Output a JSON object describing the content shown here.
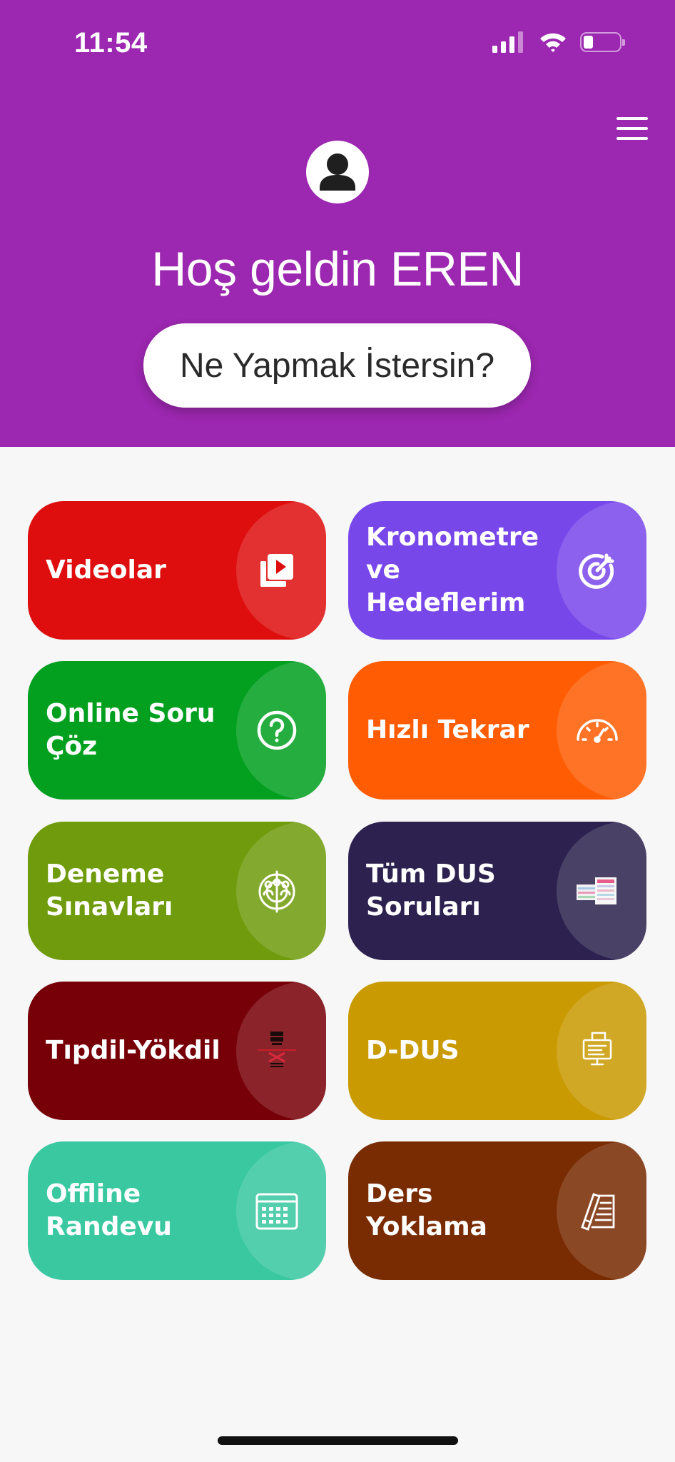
{
  "status_bar": {
    "time": "11:54"
  },
  "header": {
    "greeting": "Hoş geldin EREN",
    "prompt_button": "Ne Yapmak İstersin?",
    "background_color": "#9c27b0"
  },
  "menu": {
    "icon": "hamburger-menu-icon"
  },
  "cards": [
    {
      "label": "Videolar",
      "color": "#df0e0e",
      "icon": "video-library-icon"
    },
    {
      "label": "Kronometre ve Hedeflerim",
      "color": "#7847ea",
      "icon": "target-icon"
    },
    {
      "label": "Online Soru Çöz",
      "color": "#03a020",
      "icon": "question-circle-icon"
    },
    {
      "label": "Hızlı Tekrar",
      "color": "#ff5c03",
      "icon": "speedometer-icon"
    },
    {
      "label": "Deneme Sınavları",
      "color": "#6f9b0c",
      "icon": "group-target-icon"
    },
    {
      "label": "Tüm DUS Soruları",
      "color": "#2d224f",
      "icon": "book-thumbnail-icon"
    },
    {
      "label": "Tıpdil-Yökdil",
      "color": "#770008",
      "icon": "tipdil-logo-icon"
    },
    {
      "label": "D-DUS",
      "color": "#c99a02",
      "icon": "monitor-document-icon"
    },
    {
      "label": "Offline Randevu",
      "color": "#39c8a0",
      "icon": "calendar-icon"
    },
    {
      "label": "Ders Yoklama",
      "color": "#792b02",
      "icon": "pencil-list-icon"
    }
  ]
}
